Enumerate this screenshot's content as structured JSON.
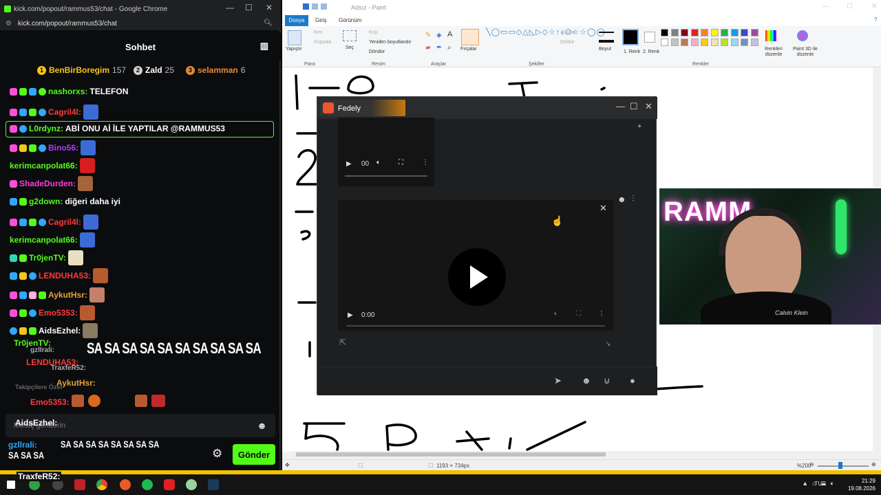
{
  "chrome": {
    "window_title": "kick.com/popout/rammus53/chat - Google Chrome",
    "url": "kick.com/popout/rammus53/chat"
  },
  "chat": {
    "header_title": "Sohbet",
    "leaderboard": [
      {
        "rank": "1",
        "name": "BenBirBoregim",
        "count": "157",
        "color": "#f5c518"
      },
      {
        "rank": "2",
        "name": "Zald",
        "count": "25",
        "color": "#d0d0d0"
      },
      {
        "rank": "3",
        "name": "selamman",
        "count": "6",
        "color": "#e08a3c"
      }
    ],
    "messages": [
      {
        "user": "nashorxs",
        "sep": ":",
        "text": "TELEFON",
        "color": "#53fc18"
      },
      {
        "user": "Cagril4l",
        "sep": ":",
        "text": "",
        "color": "#ff3b3b"
      },
      {
        "user": "L0rdynz",
        "sep": ":",
        "text": "ABİ ONU Aİ İLE YAPTILAR @RAMMUS53",
        "color": "#53fc18"
      },
      {
        "user": "Bino56",
        "sep": ":",
        "text": "",
        "color": "#b03bff"
      },
      {
        "user": "kerimcanpolat66",
        "sep": ":",
        "text": "",
        "color": "#53fc18"
      },
      {
        "user": "ShadeDurden",
        "sep": ":",
        "text": "",
        "color": "#ff3bd5"
      },
      {
        "user": "g2down",
        "sep": ":",
        "text": "diğeri daha iyi",
        "color": "#53fc18"
      },
      {
        "user": "Cagril4l",
        "sep": ":",
        "text": "",
        "color": "#ff3b3b"
      },
      {
        "user": "kerimcanpolat66",
        "sep": ":",
        "text": "",
        "color": "#53fc18"
      },
      {
        "user": "Tr0jenTV",
        "sep": ":",
        "text": "",
        "color": "#53fc18"
      },
      {
        "user": "LENDUHA53",
        "sep": ":",
        "text": "",
        "color": "#ff3b3b"
      },
      {
        "user": "AykutHsr",
        "sep": ":",
        "text": "",
        "color": "#e8a232"
      },
      {
        "user": "Emo5353",
        "sep": ":",
        "text": "",
        "color": "#ff3b3b"
      },
      {
        "user": "AidsEzhel",
        "sep": ":",
        "text": "",
        "color": "#ffffff"
      }
    ],
    "flood_text": "SA SA SA SA SA SA SA SA SA SA",
    "overlay_lines": [
      {
        "user": "Tr0jenTV:",
        "color": "#53fc18"
      },
      {
        "user": "gzllrali:",
        "color": "#aaaaaa"
      },
      {
        "user": "LENDUHA53:",
        "color": "#ff3b3b"
      },
      {
        "user": "TraxfeR52:",
        "color": "#aaaaaa"
      },
      {
        "user": "AykutHsr:",
        "color": "#e8a232"
      },
      {
        "user": "Takipçilere Özel",
        "color": "#666666"
      },
      {
        "user": "Emo5353:",
        "color": "#ff3b3b"
      }
    ],
    "input_placeholder": "Mesaj gönderin",
    "input_overlay_user": "AidsEzhel:",
    "send_label": "Gönder",
    "bottom_user": "gzllrali:",
    "bottom_text": "SA SA SA SA SA SA SA SA",
    "bottom_text2": "SA SA SA",
    "taskbar_user": "TraxfeR52:"
  },
  "paint": {
    "window_title": "Adsız - Paint",
    "tabs": [
      "Dosya",
      "Giriş",
      "Görünüm"
    ],
    "groups": [
      "Pano",
      "Resim",
      "Araçlar",
      "Şekiller",
      "Renkler"
    ],
    "buttons": {
      "paste": "Yapıştır",
      "cut": "Kes",
      "copy": "Kopyala",
      "select": "Seç",
      "crop": "Kırp",
      "resize": "Yeniden boyutlandır",
      "rotate": "Döndür",
      "brushes": "Fırçalar",
      "outline": "Anahat",
      "fill": "Doldur",
      "size": "Boyut",
      "color1": "1. Renk",
      "color2": "2. Renk",
      "edit_colors": "Renkleri düzenle",
      "paint3d": "Paint 3D ile düzenle"
    },
    "status_size": "1193 × 734px",
    "zoom": "%200",
    "palette": [
      "#000000",
      "#7f7f7f",
      "#880015",
      "#ed1c24",
      "#ff7f27",
      "#fff200",
      "#22b14c",
      "#00a2e8",
      "#3f48cc",
      "#a349a4",
      "#ffffff",
      "#c3c3c3",
      "#b97a57",
      "#ffaec9",
      "#ffc90e",
      "#efe4b0",
      "#b5e61d",
      "#99d9ea",
      "#7092be",
      "#c8bfe7"
    ]
  },
  "fedely": {
    "title": "Fedely",
    "small_time": "00",
    "big_time": "0:00"
  },
  "webcam": {
    "neon_text": "RAMM",
    "shirt_brand": "Calvin Klein"
  },
  "taskbar": {
    "lang": "TUR",
    "time": "21:29",
    "date": "19.08.2026"
  }
}
